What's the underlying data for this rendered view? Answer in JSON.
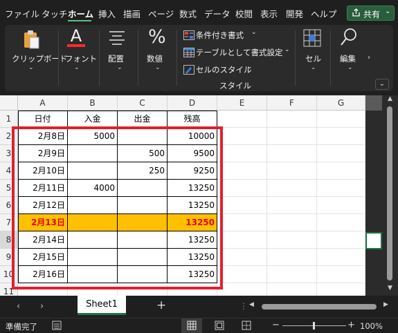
{
  "tabs": [
    "ファイル",
    "タッチ",
    "ホーム",
    "挿入",
    "描画",
    "ページ",
    "数式",
    "データ",
    "校閲",
    "表示",
    "開発",
    "ヘルプ"
  ],
  "active_tab": "ホーム",
  "share_label": "共有",
  "ribbon": {
    "clipboard": "クリップボード",
    "font": "フォント",
    "alignment": "配置",
    "number": "数値",
    "conditional_formatting": "条件付き書式",
    "format_as_table": "テーブルとして書式設定",
    "cell_styles": "セルのスタイル",
    "styles_group": "スタイル",
    "cells": "セル",
    "editing": "編集"
  },
  "columns": [
    "A",
    "B",
    "C",
    "D",
    "E",
    "F",
    "G"
  ],
  "rows": [
    "1",
    "2",
    "3",
    "4",
    "5",
    "6",
    "7",
    "8",
    "9",
    "10",
    "11"
  ],
  "table": {
    "headers": [
      "日付",
      "入金",
      "出金",
      "残高"
    ],
    "data": [
      [
        "2月8日",
        "5000",
        "",
        "10000"
      ],
      [
        "2月9日",
        "",
        "500",
        "9500"
      ],
      [
        "2月10日",
        "",
        "250",
        "9250"
      ],
      [
        "2月11日",
        "4000",
        "",
        "13250"
      ],
      [
        "2月12日",
        "",
        "",
        "13250"
      ],
      [
        "2月13日",
        "",
        "",
        "13250"
      ],
      [
        "2月14日",
        "",
        "",
        "13250"
      ],
      [
        "2月15日",
        "",
        "",
        "13250"
      ],
      [
        "2月16日",
        "",
        "",
        "13250"
      ]
    ],
    "highlighted_row": "2月13日",
    "highlight_fill": "#ffc000",
    "highlight_text": "#e60000"
  },
  "annotation_color": "#e0202b",
  "sheet_tab": "Sheet1",
  "status": {
    "ready": "準備完了",
    "zoom": "100%"
  },
  "icons": [
    "share-icon",
    "clipboard-icon",
    "font-icon",
    "alignment-icon",
    "percent-icon",
    "conditional-format-icon",
    "table-format-icon",
    "cell-style-icon",
    "cells-icon",
    "search-icon"
  ]
}
